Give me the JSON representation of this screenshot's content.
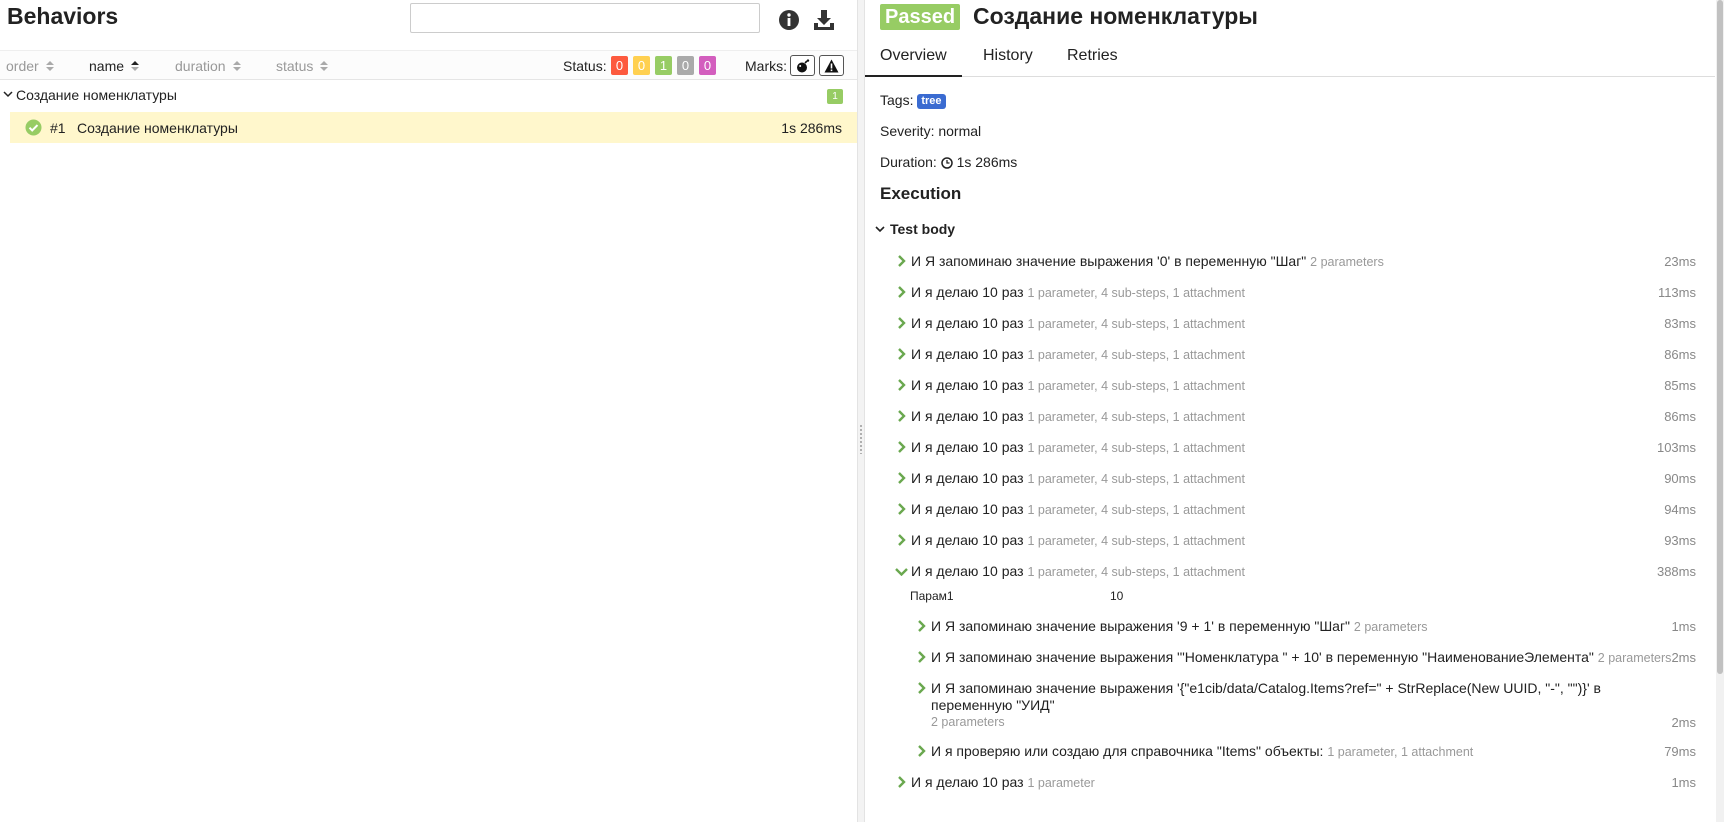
{
  "left": {
    "title": "Behaviors",
    "search_value": "",
    "sort_columns": [
      {
        "label": "order",
        "active": false
      },
      {
        "label": "name",
        "active": true
      },
      {
        "label": "duration",
        "active": false
      },
      {
        "label": "status",
        "active": false
      }
    ],
    "status_label": "Status:",
    "status_counts": [
      {
        "value": "0",
        "color": "#fd5a3e"
      },
      {
        "value": "0",
        "color": "#ffd050"
      },
      {
        "value": "1",
        "color": "#97cc64"
      },
      {
        "value": "0",
        "color": "#aaaaaa"
      },
      {
        "value": "0",
        "color": "#d35ebe"
      }
    ],
    "marks_label": "Marks:",
    "group": {
      "title": "Создание номенклатуры",
      "count": "1"
    },
    "test": {
      "number": "#1",
      "name": "Создание номенклатуры",
      "duration": "1s 286ms"
    }
  },
  "right": {
    "status_badge": "Passed",
    "title": "Создание номенклатуры",
    "tabs": [
      "Overview",
      "History",
      "Retries"
    ],
    "tags_label": "Tags:",
    "tag": "tree",
    "severity": "Severity: normal",
    "duration_label": "Duration:",
    "duration_value": "1s 286ms",
    "execution_title": "Execution",
    "test_body_label": "Test body",
    "steps": [
      {
        "text": "И Я запоминаю значение выражения '0' в переменную \"Шаг\"",
        "meta": "2 parameters",
        "duration": "23ms"
      },
      {
        "text": "И я делаю 10 раз",
        "meta": "1 parameter, 4 sub-steps, 1 attachment",
        "duration": "113ms"
      },
      {
        "text": "И я делаю 10 раз",
        "meta": "1 parameter, 4 sub-steps, 1 attachment",
        "duration": "83ms"
      },
      {
        "text": "И я делаю 10 раз",
        "meta": "1 parameter, 4 sub-steps, 1 attachment",
        "duration": "86ms"
      },
      {
        "text": "И я делаю 10 раз",
        "meta": "1 parameter, 4 sub-steps, 1 attachment",
        "duration": "85ms"
      },
      {
        "text": "И я делаю 10 раз",
        "meta": "1 parameter, 4 sub-steps, 1 attachment",
        "duration": "86ms"
      },
      {
        "text": "И я делаю 10 раз",
        "meta": "1 parameter, 4 sub-steps, 1 attachment",
        "duration": "103ms"
      },
      {
        "text": "И я делаю 10 раз",
        "meta": "1 parameter, 4 sub-steps, 1 attachment",
        "duration": "90ms"
      },
      {
        "text": "И я делаю 10 раз",
        "meta": "1 parameter, 4 sub-steps, 1 attachment",
        "duration": "94ms"
      },
      {
        "text": "И я делаю 10 раз",
        "meta": "1 parameter, 4 sub-steps, 1 attachment",
        "duration": "93ms"
      },
      {
        "text": "И я делаю 10 раз",
        "meta": "1 parameter, 4 sub-steps, 1 attachment",
        "duration": "388ms",
        "expanded": true
      }
    ],
    "expanded_param": {
      "name": "Парам1",
      "value": "10"
    },
    "sub_steps": [
      {
        "text": "И Я запоминаю значение выражения '9 + 1' в переменную \"Шаг\"",
        "meta": "2 parameters",
        "duration": "1ms"
      },
      {
        "text": "И Я запоминаю значение выражения '\"Номенклатура \" + 10' в переменную \"НаименованиеЭлемента\"",
        "meta": "2 parameters",
        "duration": "2ms"
      },
      {
        "text_line1": "И Я запоминаю значение выражения '{\"e1cib/data/Catalog.Items?ref=\" + StrReplace(New UUID, \"-\", \"\")}' в",
        "text_line2": "переменную \"УИД\"",
        "meta": "2 parameters",
        "duration": "2ms"
      },
      {
        "text": "И я проверяю или создаю для справочника \"Items\" объекты:",
        "meta": "1 parameter, 1 attachment",
        "duration": "79ms"
      }
    ],
    "last_step": {
      "text": "И я делаю 10 раз",
      "meta": "1 parameter",
      "duration": "1ms"
    }
  }
}
